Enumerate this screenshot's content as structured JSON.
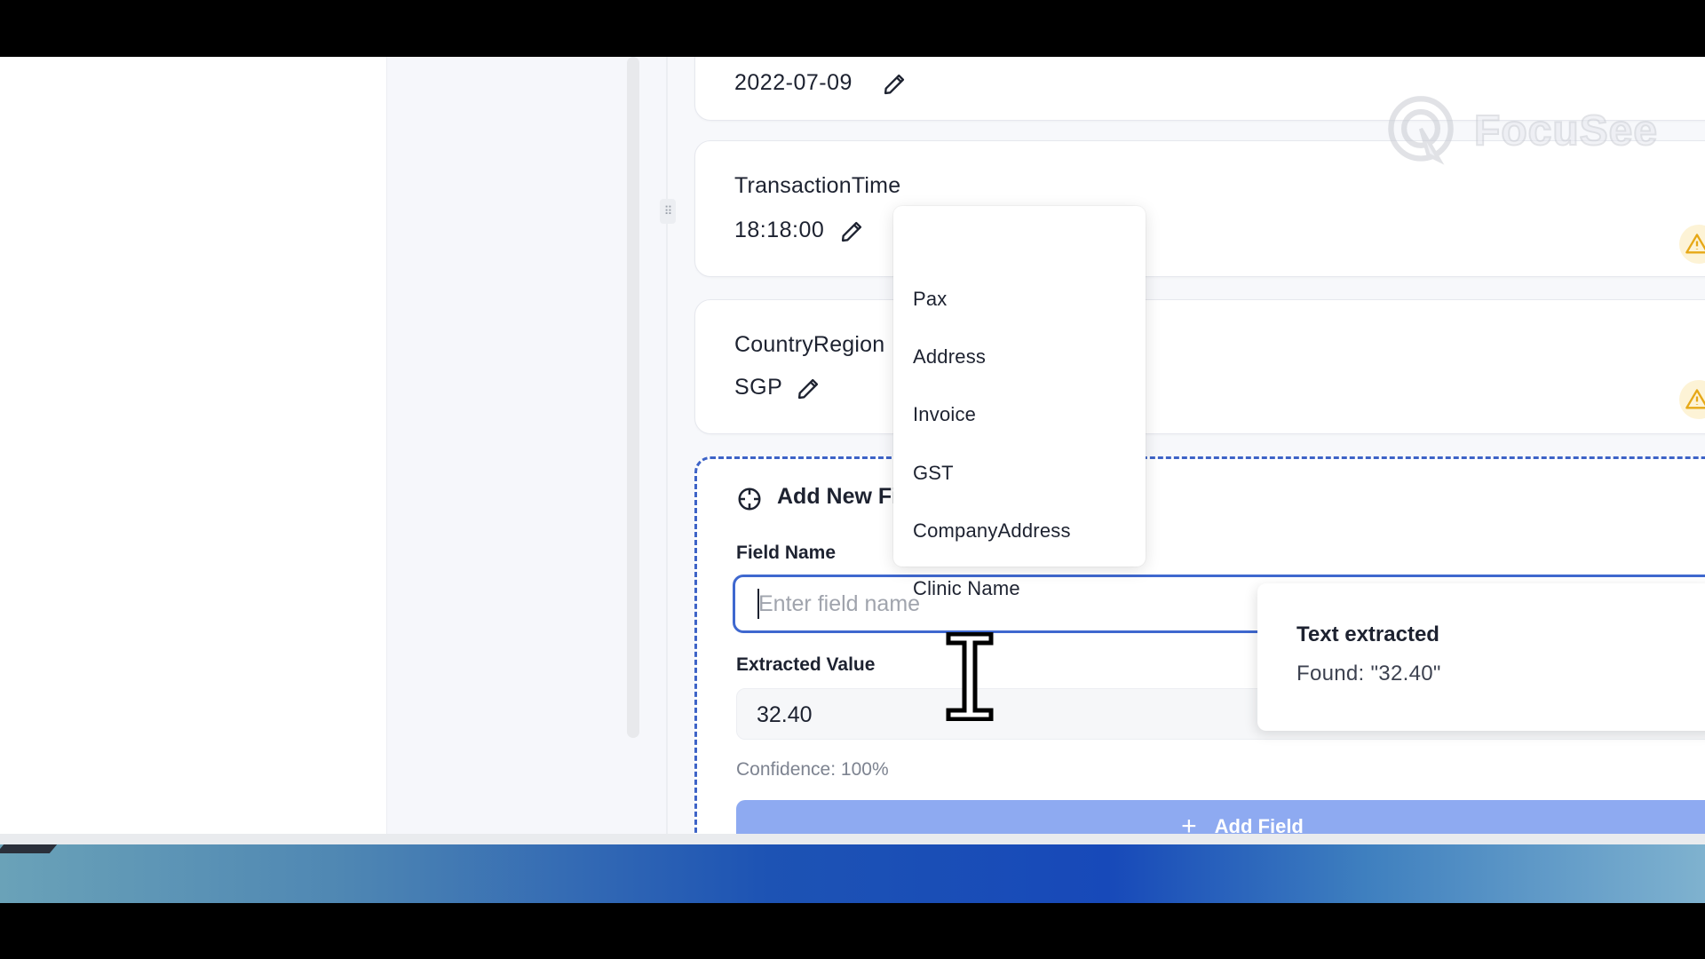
{
  "cards": {
    "date": {
      "value": "2022-07-09"
    },
    "time": {
      "label": "TransactionTime",
      "value": "18:18:00"
    },
    "country": {
      "label": "CountryRegion",
      "value": "SGP"
    }
  },
  "add_field": {
    "title": "Add New Fi",
    "field_name_label": "Field Name",
    "field_name_placeholder": "Enter field name",
    "extracted_value_label": "Extracted Value",
    "extracted_value": "32.40",
    "confidence": "Confidence: 100%",
    "button_label": "Add Field"
  },
  "dropdown": {
    "items": [
      "Pax",
      "Address",
      "Invoice",
      "GST",
      "CompanyAddress",
      "Clinic Name"
    ]
  },
  "toast": {
    "title": "Text extracted",
    "body": "Found: \"32.40\""
  },
  "watermark": {
    "text": "FocuSee"
  },
  "colors": {
    "accent": "#3f68cf",
    "button": "#8eaaf1",
    "warning_bg": "#fdf3d6",
    "warning": "#e6a817"
  },
  "icons": [
    "edit-icon",
    "warning-icon",
    "crosshair-icon",
    "plus-icon",
    "drag-handle-icon",
    "focusee-logo-icon"
  ]
}
